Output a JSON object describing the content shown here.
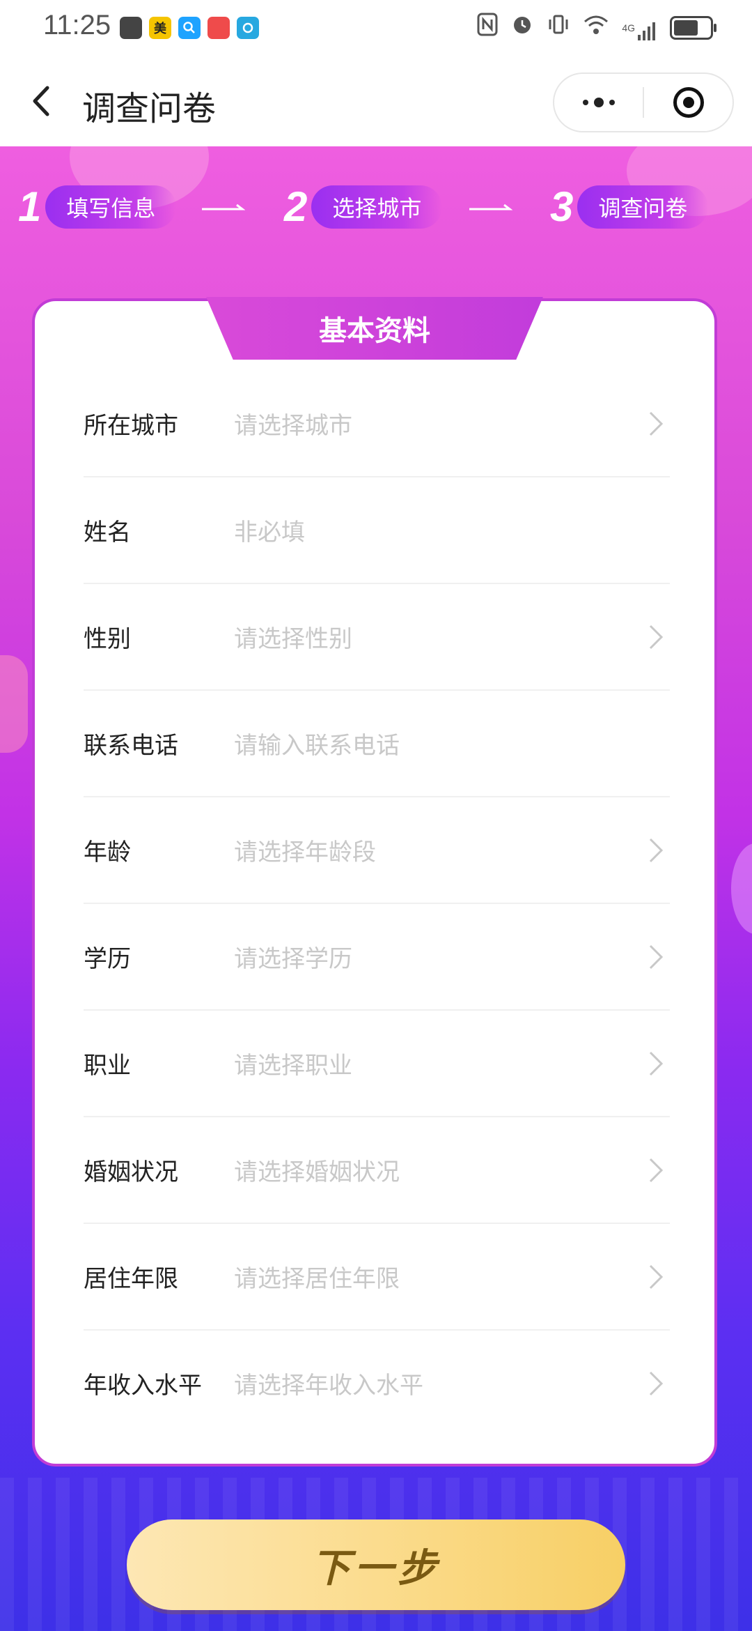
{
  "status_bar": {
    "time": "11:25",
    "apps": [
      {
        "name": "huawei-app-icon",
        "label": "",
        "color": "#444444"
      },
      {
        "name": "meituan-app-icon",
        "label": "美",
        "color": "#f5c400"
      },
      {
        "name": "search-app-icon",
        "label": "",
        "color": "#1ea3ff"
      },
      {
        "name": "huawei-mall-app-icon",
        "label": "",
        "color": "#ef4b4b"
      },
      {
        "name": "browser-app-icon",
        "label": "",
        "color": "#27a8e0"
      }
    ],
    "network": "4G"
  },
  "nav": {
    "title": "调查问卷"
  },
  "steps": [
    {
      "num": "1",
      "label": "填写信息"
    },
    {
      "num": "2",
      "label": "选择城市"
    },
    {
      "num": "3",
      "label": "调查问卷"
    }
  ],
  "card": {
    "title": "基本资料",
    "rows": [
      {
        "label": "所在城市",
        "placeholder": "请选择城市",
        "has_chevron": true
      },
      {
        "label": "姓名",
        "placeholder": "非必填",
        "has_chevron": false
      },
      {
        "label": "性别",
        "placeholder": "请选择性别",
        "has_chevron": true
      },
      {
        "label": "联系电话",
        "placeholder": "请输入联系电话",
        "has_chevron": false
      },
      {
        "label": "年龄",
        "placeholder": "请选择年龄段",
        "has_chevron": true
      },
      {
        "label": "学历",
        "placeholder": "请选择学历",
        "has_chevron": true
      },
      {
        "label": "职业",
        "placeholder": "请选择职业",
        "has_chevron": true
      },
      {
        "label": "婚姻状况",
        "placeholder": "请选择婚姻状况",
        "has_chevron": true
      },
      {
        "label": "居住年限",
        "placeholder": "请选择居住年限",
        "has_chevron": true
      },
      {
        "label": "年收入水平",
        "placeholder": "请选择年收入水平",
        "has_chevron": true
      }
    ]
  },
  "next_button": {
    "label": "下一步"
  },
  "colors": {
    "accent": "#c232e6",
    "button_gold": "#f7cf65",
    "placeholder": "#c8c8c8"
  }
}
